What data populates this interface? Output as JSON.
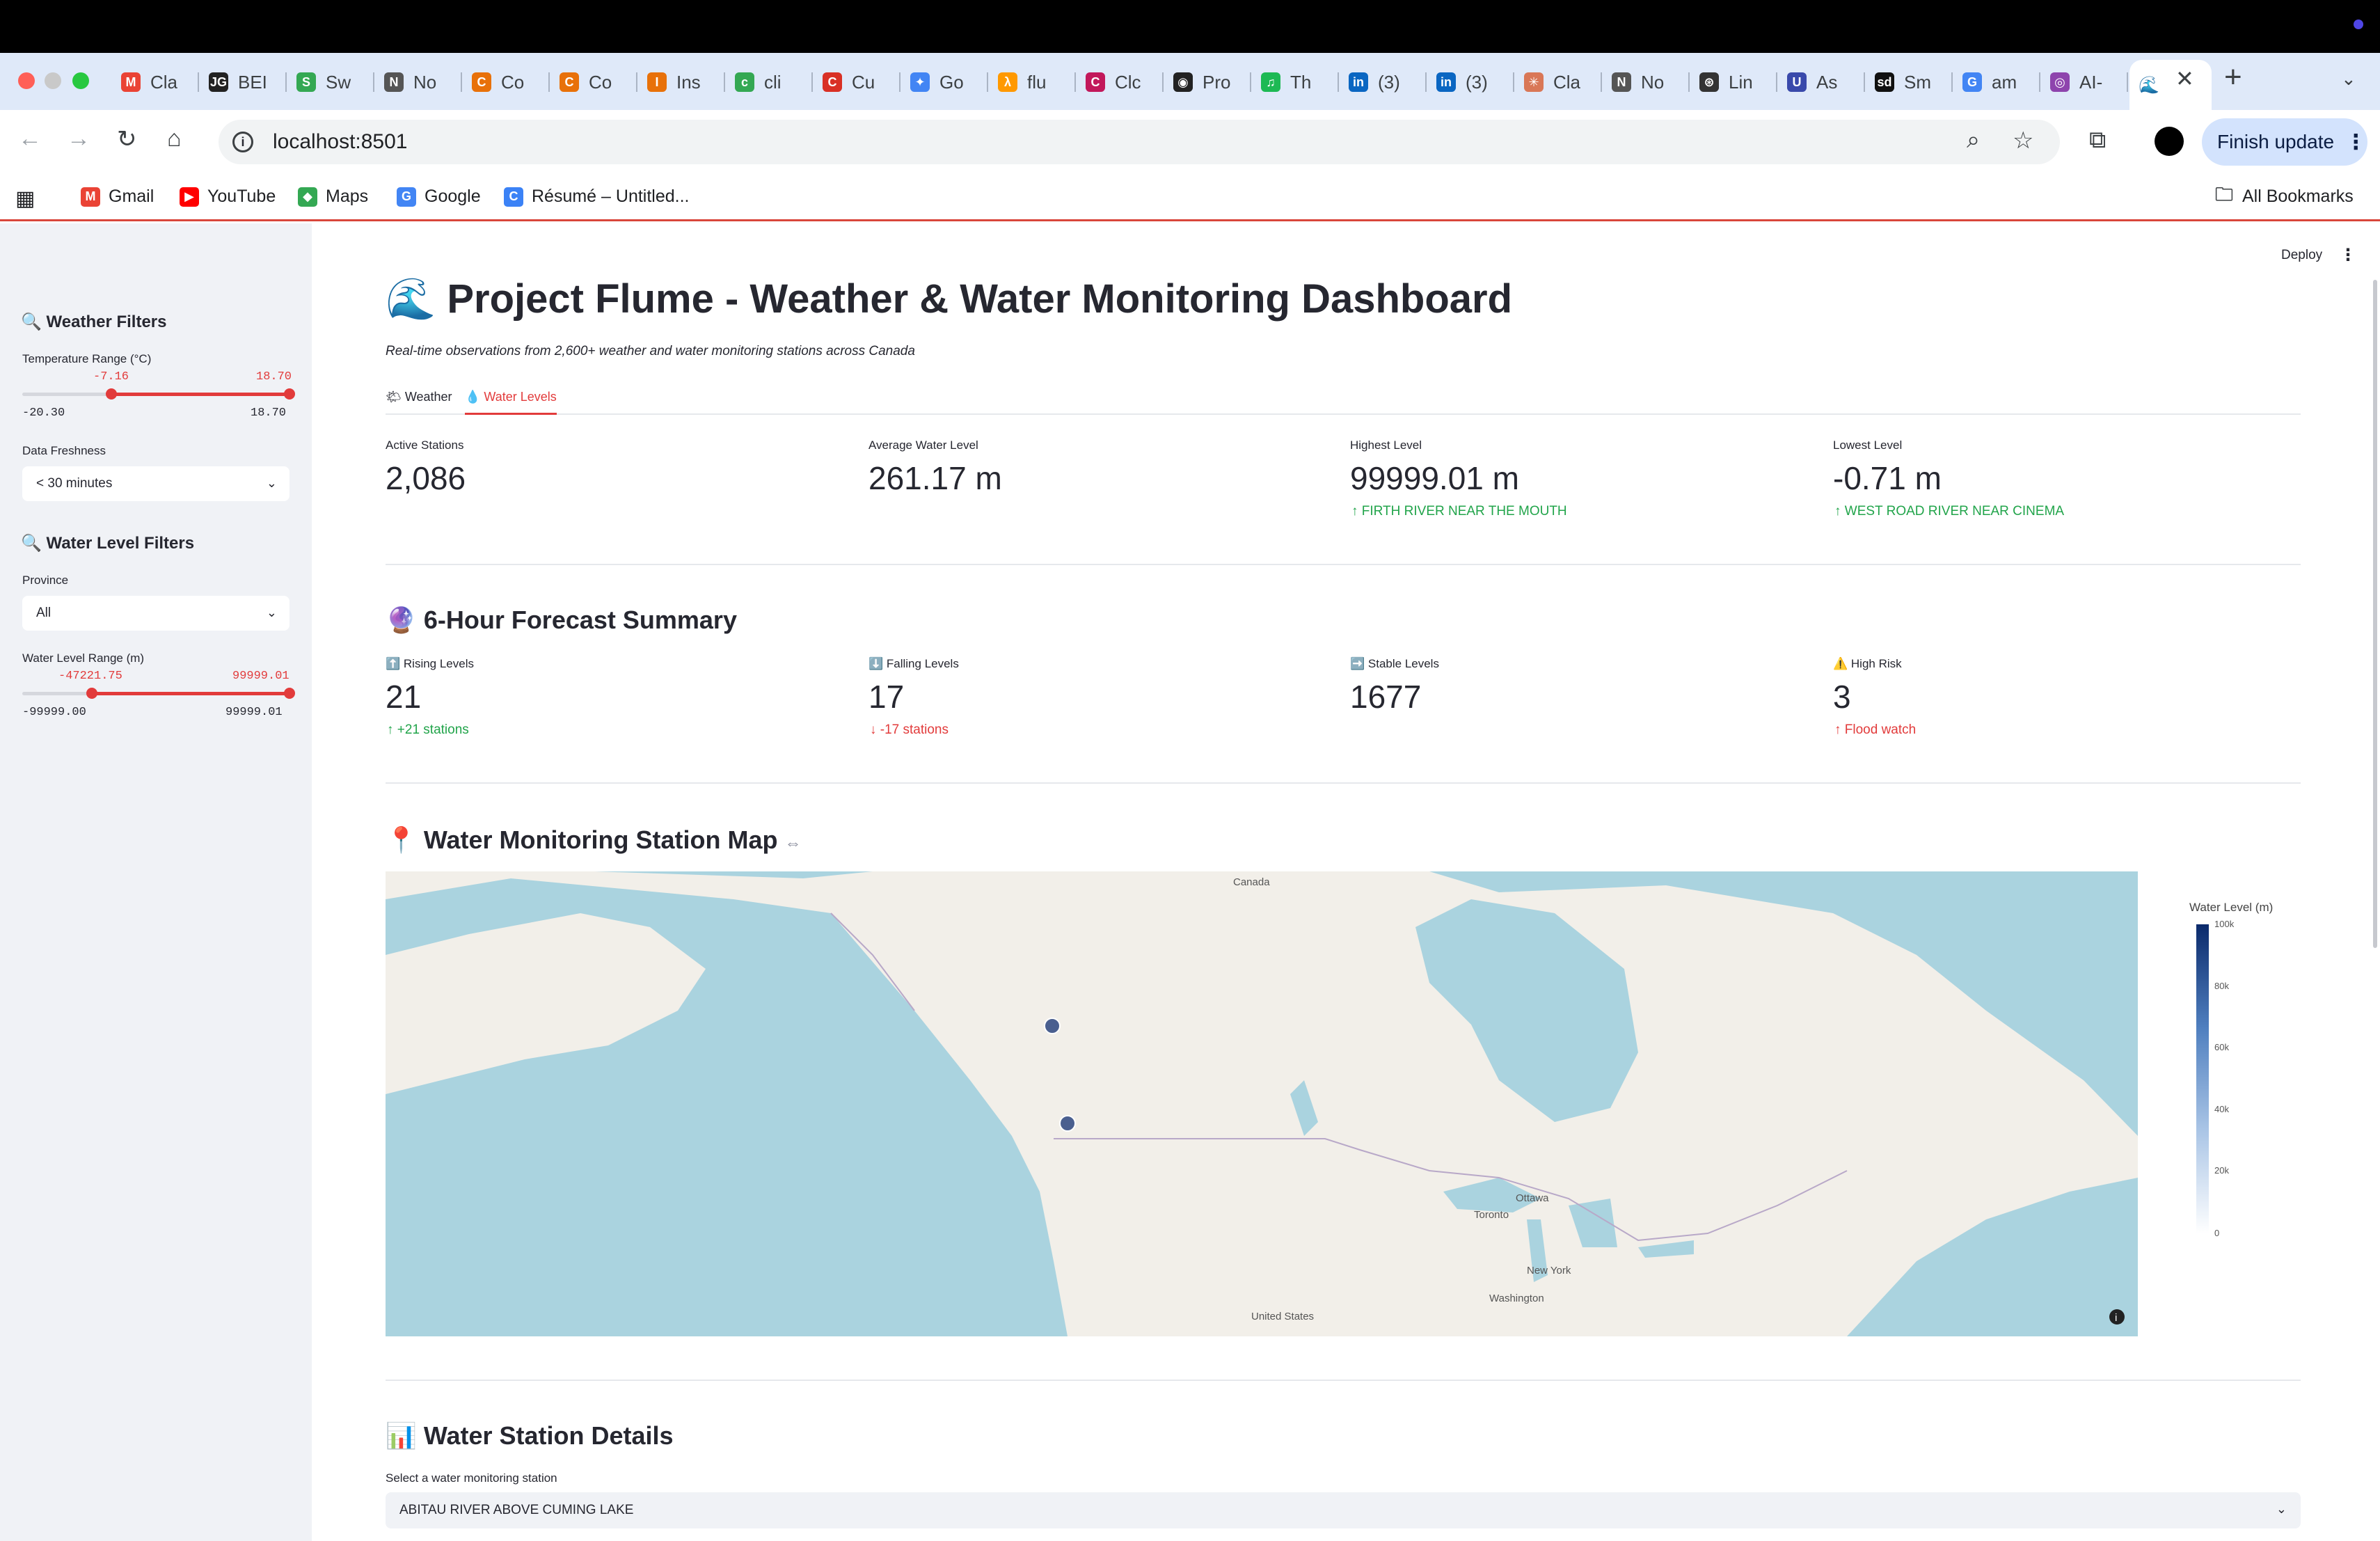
{
  "browser": {
    "tabs": [
      {
        "label": "Cla",
        "fav": "M",
        "color": "#ea4335"
      },
      {
        "label": "BEI",
        "fav": "JG",
        "color": "#222222"
      },
      {
        "label": "Sw",
        "fav": "S",
        "color": "#34a853"
      },
      {
        "label": "No",
        "fav": "N",
        "color": "#555555"
      },
      {
        "label": "Co",
        "fav": "C",
        "color": "#e8710a"
      },
      {
        "label": "Co",
        "fav": "C",
        "color": "#e8710a"
      },
      {
        "label": "Ins",
        "fav": "I",
        "color": "#e8710a"
      },
      {
        "label": "cli",
        "fav": "c",
        "color": "#34a853"
      },
      {
        "label": "Cu",
        "fav": "C",
        "color": "#d93025"
      },
      {
        "label": "Go",
        "fav": "✦",
        "color": "#4285f4"
      },
      {
        "label": "flu",
        "fav": "λ",
        "color": "#ff9900"
      },
      {
        "label": "Clc",
        "fav": "C",
        "color": "#c2185b"
      },
      {
        "label": "Pro",
        "fav": "◉",
        "color": "#222222"
      },
      {
        "label": "Th",
        "fav": "♫",
        "color": "#1db954"
      },
      {
        "label": "(3)",
        "fav": "in",
        "color": "#0a66c2"
      },
      {
        "label": "(3)",
        "fav": "in",
        "color": "#0a66c2"
      },
      {
        "label": "Cla",
        "fav": "✳",
        "color": "#d97757"
      },
      {
        "label": "No",
        "fav": "N",
        "color": "#555555"
      },
      {
        "label": "Lin",
        "fav": "⊛",
        "color": "#333333"
      },
      {
        "label": "As",
        "fav": "U",
        "color": "#3949ab"
      },
      {
        "label": "Sm",
        "fav": "sd",
        "color": "#111111"
      },
      {
        "label": "am",
        "fav": "G",
        "color": "#4285f4"
      },
      {
        "label": "AI-",
        "fav": "◎",
        "color": "#8e44ad"
      }
    ],
    "active_tab_icon": "🌊",
    "url": "localhost:8501",
    "finish_update": "Finish update",
    "bookmarks": [
      {
        "label": "Gmail",
        "icon": "M",
        "color": "#ea4335"
      },
      {
        "label": "YouTube",
        "icon": "▶",
        "color": "#ff0000"
      },
      {
        "label": "Maps",
        "icon": "◆",
        "color": "#34a853"
      },
      {
        "label": "Google",
        "icon": "G",
        "color": "#4285f4"
      },
      {
        "label": "Résumé – Untitled...",
        "icon": "C",
        "color": "#3b82f6"
      }
    ],
    "all_bookmarks": "All Bookmarks"
  },
  "sidebar": {
    "weather_filters": "🔍 Weather Filters",
    "temp_label": "Temperature Range (°C)",
    "temp_low": "-7.16",
    "temp_high": "18.70",
    "temp_min": "-20.30",
    "temp_max": "18.70",
    "freshness_label": "Data Freshness",
    "freshness_value": "< 30 minutes",
    "water_filters": "🔍 Water Level Filters",
    "province_label": "Province",
    "province_value": "All",
    "water_range_label": "Water Level Range (m)",
    "water_low": "-47221.75",
    "water_high": "99999.01",
    "water_min": "-99999.00",
    "water_max": "99999.01"
  },
  "app": {
    "deploy": "Deploy",
    "title": "🌊 Project Flume - Weather & Water Monitoring Dashboard",
    "caption": "Real-time observations from 2,600+ weather and water monitoring stations across Canada",
    "tabs": {
      "weather": "🌤 Weather",
      "water": "💧 Water Levels"
    },
    "metrics": [
      {
        "label": "Active Stations",
        "value": "2,086",
        "delta": ""
      },
      {
        "label": "Average Water Level",
        "value": "261.17 m",
        "delta": ""
      },
      {
        "label": "Highest Level",
        "value": "99999.01 m",
        "delta": "↑ FIRTH RIVER NEAR THE MOUTH"
      },
      {
        "label": "Lowest Level",
        "value": "-0.71 m",
        "delta": "↑ WEST ROAD RIVER NEAR CINEMA"
      }
    ],
    "forecast_title": "🔮 6-Hour Forecast Summary",
    "forecast": [
      {
        "label": "⬆️ Rising Levels",
        "value": "21",
        "delta": "↑ +21 stations"
      },
      {
        "label": "⬇️ Falling Levels",
        "value": "17",
        "delta": "↓ -17 stations"
      },
      {
        "label": "➡️ Stable Levels",
        "value": "1677",
        "delta": ""
      },
      {
        "label": "⚠️ High Risk",
        "value": "3",
        "delta": "↑ Flood watch"
      }
    ],
    "map_title": "📍 Water Monitoring Station Map",
    "map_link_icon": "⇔",
    "map_labels": {
      "canada": "Canada",
      "ottawa": "Ottawa",
      "toronto": "Toronto",
      "newyork": "New York",
      "washington": "Washington",
      "us": "United States"
    },
    "colorbar": {
      "title": "Water Level (m)",
      "ticks": [
        "100k",
        "80k",
        "60k",
        "40k",
        "20k",
        "0"
      ]
    },
    "details_title": "📊 Water Station Details",
    "select_label": "Select a water monitoring station",
    "select_value": "ABITAU RIVER ABOVE CUMING LAKE"
  }
}
